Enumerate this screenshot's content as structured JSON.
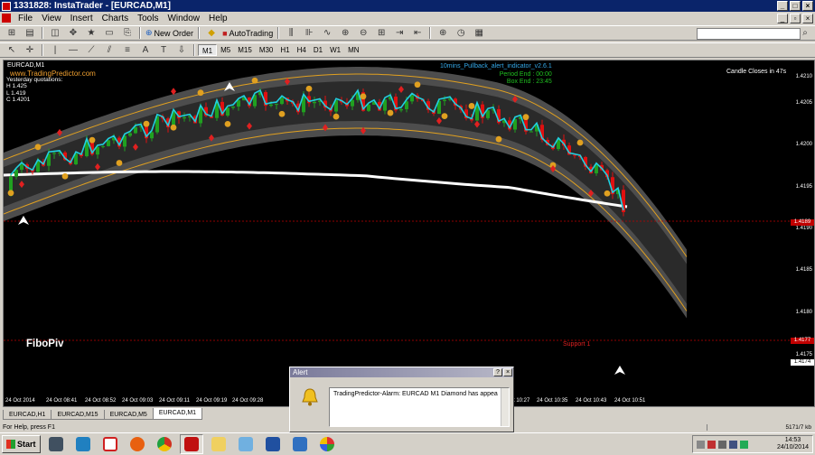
{
  "window": {
    "title": "1331828: InstaTrader - [EURCAD,M1]"
  },
  "menu": [
    "File",
    "View",
    "Insert",
    "Charts",
    "Tools",
    "Window",
    "Help"
  ],
  "toolbar": {
    "new_order": "New Order",
    "auto_trading": "AutoTrading",
    "timeframes": [
      "M1",
      "M5",
      "M15",
      "M30",
      "H1",
      "H4",
      "D1",
      "W1",
      "MN"
    ],
    "active_timeframe": "M1"
  },
  "chart": {
    "symbol": "EURCAD,M1",
    "site": "www.TradingPredictor.com",
    "quotes_title": "Yesterday quotations:",
    "high": "H 1.425",
    "low": "L 1.419",
    "close": "C 1.4201",
    "indicator_name": "10mins_Pullback_alert_indicator_v2.6.1",
    "period_end": "Period End : 00:00",
    "box_end": "Box End : 23:45",
    "candle_close": "Candle Closes in 47s",
    "fibo": "FiboPiv",
    "support": "Support 1",
    "price_axis": [
      "1.4210",
      "1.4205",
      "1.4200",
      "1.4195",
      "1.4190",
      "1.4185",
      "1.4180",
      "1.4175"
    ],
    "price_box_red": "1.4189",
    "price_box_support": "1.4177",
    "price_current": "1.4174",
    "time_axis": [
      "24 Oct 2014",
      "24 Oct 08:41",
      "24 Oct 08:52",
      "24 Oct 09:03",
      "24 Oct 09:11",
      "24 Oct 09:19",
      "24 Oct 09:28",
      "24 Oct 10:27",
      "24 Oct 10:35",
      "24 Oct 10:43",
      "24 Oct 10:51"
    ]
  },
  "chart_tabs": [
    "EURCAD,H1",
    "EURCAD,M15",
    "EURCAD,M5",
    "EURCAD,M1"
  ],
  "active_chart_tab": "EURCAD,M1",
  "status": {
    "help": "For Help, press F1",
    "traffic": "5171/7 kb"
  },
  "alert": {
    "title": "Alert",
    "message": "TradingPredictor-Alarm:  EURCAD M1  Diamond has appea"
  },
  "taskbar": {
    "start": "Start",
    "time": "14:53",
    "date": "24/10/2014",
    "apps": [
      "windows-media-icon",
      "tool-icon",
      "plus-icon",
      "firefox-icon",
      "chrome-icon",
      "instatrader-icon",
      "folder-icon",
      "notepad-icon",
      "explorer-icon",
      "trader-icon",
      "picasa-icon"
    ]
  },
  "colors": {
    "bull": "#20a020",
    "bear": "#e01010",
    "ma_fast": "#20d0e0",
    "ma_slow": "#ffffff",
    "band": "#e0a020"
  }
}
